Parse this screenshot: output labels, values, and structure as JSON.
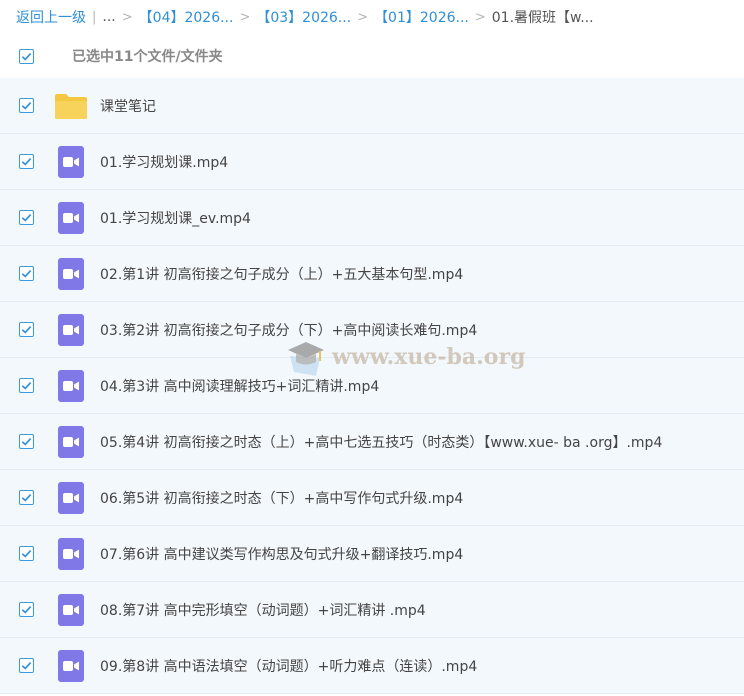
{
  "breadcrumb": {
    "back": "返回上一级",
    "divider": "|",
    "ellipsis": "...",
    "items": [
      "【04】2026...",
      "【03】2026...",
      "【01】2026..."
    ],
    "current": "01.暑假班【w..."
  },
  "selection": {
    "label": "已选中11个文件/文件夹"
  },
  "files": [
    {
      "name": "课堂笔记",
      "icon": "folder-icon"
    },
    {
      "name": "01.学习规划课.mp4",
      "icon": "video-icon"
    },
    {
      "name": "01.学习规划课_ev.mp4",
      "icon": "video-icon"
    },
    {
      "name": "02.第1讲 初高衔接之句子成分（上）+五大基本句型.mp4",
      "icon": "video-icon"
    },
    {
      "name": "03.第2讲 初高衔接之句子成分（下）+高中阅读长难句.mp4",
      "icon": "video-icon"
    },
    {
      "name": "04.第3讲 高中阅读理解技巧+词汇精讲.mp4",
      "icon": "video-icon"
    },
    {
      "name": "05.第4讲 初高衔接之时态（上）+高中七选五技巧（时态类）【www.xue- ba .org】.mp4",
      "icon": "video-icon"
    },
    {
      "name": "06.第5讲 初高衔接之时态（下）+高中写作句式升级.mp4",
      "icon": "video-icon"
    },
    {
      "name": "07.第6讲 高中建议类写作构思及句式升级+翻译技巧.mp4",
      "icon": "video-icon"
    },
    {
      "name": "08.第7讲 高中完形填空（动词题）+词汇精讲 .mp4",
      "icon": "video-icon"
    },
    {
      "name": "09.第8讲 高中语法填空（动词题）+听力难点（连读）.mp4",
      "icon": "video-icon"
    }
  ],
  "watermark": {
    "text": "www.xue-ba.org"
  },
  "colors": {
    "accent": "#2f8fd8",
    "row_bg": "#f3f8fd",
    "video": "#7f78e6",
    "folder": "#f5c842"
  }
}
